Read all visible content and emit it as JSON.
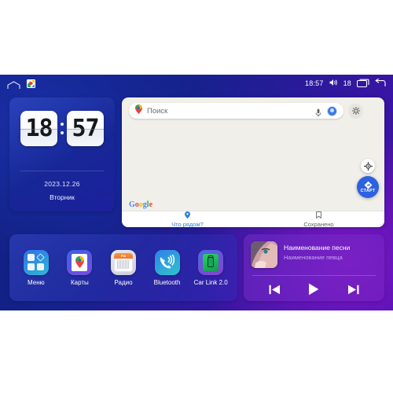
{
  "status_bar": {
    "home_icon": "home-icon",
    "maps_icon": "maps-icon",
    "time": "18:57",
    "volume_icon": "volume-icon",
    "volume_level": "18",
    "recents_icon": "recent-apps-icon",
    "back_icon": "back-icon"
  },
  "clock_widget": {
    "hours": "18",
    "minutes": "57",
    "date": "2023.12.26",
    "weekday": "Вторник"
  },
  "maps_widget": {
    "search_placeholder": "Поиск",
    "pin_icon": "map-pin-icon",
    "mic_icon": "microphone-icon",
    "avatar_icon": "account-avatar-icon",
    "gear_icon": "gear-icon",
    "locate_icon": "my-location-icon",
    "start_label": "СТАРТ",
    "brand": "Google",
    "brand_letters": [
      {
        "ch": "G",
        "color": "#4285F4"
      },
      {
        "ch": "o",
        "color": "#EA4335"
      },
      {
        "ch": "o",
        "color": "#FBBC05"
      },
      {
        "ch": "g",
        "color": "#4285F4"
      },
      {
        "ch": "l",
        "color": "#34A853"
      },
      {
        "ch": "e",
        "color": "#EA4335"
      }
    ],
    "nav": [
      {
        "label": "Что рядом?",
        "icon": "nearby-pin-icon",
        "active": true
      },
      {
        "label": "Сохранено",
        "icon": "bookmark-icon",
        "active": false
      }
    ]
  },
  "dock": {
    "apps": [
      {
        "label": "Меню",
        "icon": "apps-grid-icon"
      },
      {
        "label": "Карты",
        "icon": "maps-icon"
      },
      {
        "label": "Радио",
        "icon": "radio-icon",
        "band": "FM"
      },
      {
        "label": "Bluetooth",
        "icon": "bluetooth-phone-icon"
      },
      {
        "label": "Car Link 2.0",
        "icon": "car-link-icon"
      }
    ]
  },
  "music": {
    "title": "Наименование песни",
    "artist": "Наименование певца",
    "album_art_icon": "album-art",
    "prev_icon": "previous-track-icon",
    "play_icon": "play-icon",
    "next_icon": "next-track-icon"
  },
  "colors": {
    "accent_blue": "#2c62e5",
    "maps_bg": "#f1efe9",
    "screen_start": "#0d1f7a",
    "screen_end": "#4a0fae"
  }
}
